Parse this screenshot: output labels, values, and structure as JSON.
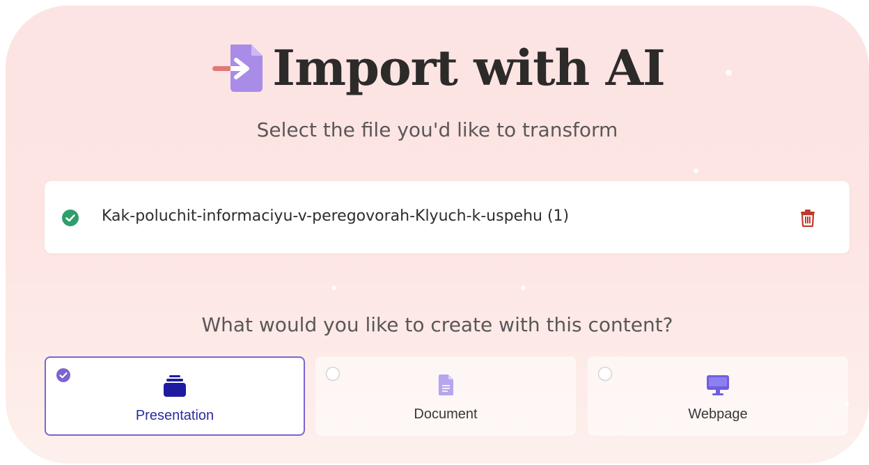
{
  "header": {
    "title": "Import with AI",
    "subtitle": "Select the file you'd like to transform",
    "icon": "file-import-icon"
  },
  "file": {
    "name": "Kak-poluchit-informaciyu-v-peregovorah-Klyuch-k-uspehu (1)",
    "status": "uploaded",
    "status_icon": "check-circle-icon",
    "delete_icon": "trash-icon"
  },
  "question": "What would you like to create with this content?",
  "options": [
    {
      "label": "Presentation",
      "icon": "presentation-icon",
      "selected": true
    },
    {
      "label": "Document",
      "icon": "document-icon",
      "selected": false
    },
    {
      "label": "Webpage",
      "icon": "monitor-icon",
      "selected": false
    }
  ],
  "colors": {
    "accent": "#7b65d0",
    "success": "#2e9e6b",
    "danger": "#c0392b",
    "selected_label": "#2b2aa0"
  }
}
